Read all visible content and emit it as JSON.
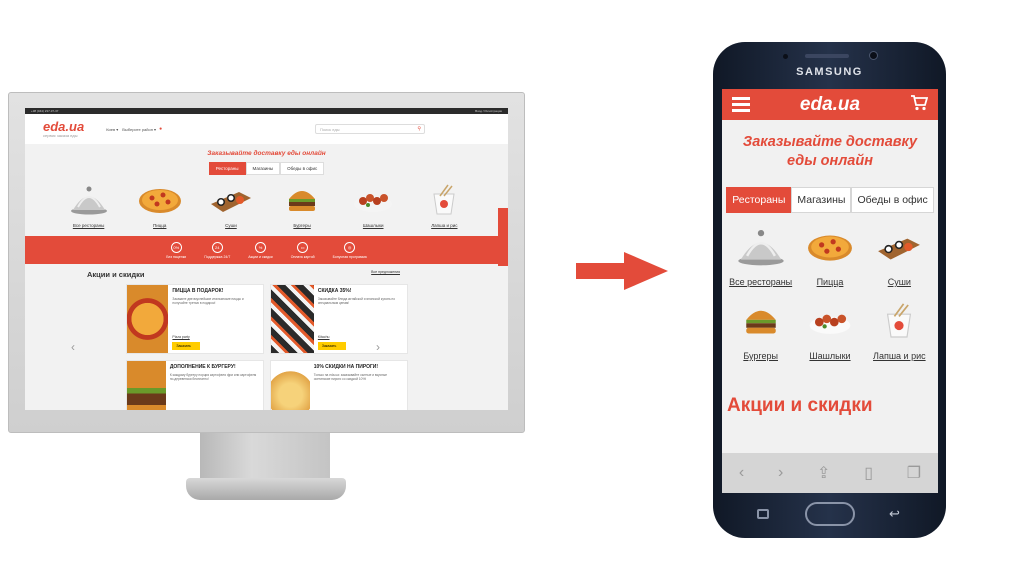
{
  "desktop": {
    "topbar": {
      "phone": "+38 (044) 237-37-37",
      "login": "Вход / Регистрация"
    },
    "logo": {
      "text": "eda.ua",
      "tagline": "сервис заказа еды"
    },
    "city": "Киев ▾",
    "district": "Выберите район ▾",
    "search_placeholder": "Поиск еды",
    "headline": "Заказывайте доставку еды онлайн",
    "tabs": [
      "Рестораны",
      "Магазины",
      "Обеды в офис"
    ],
    "categories": [
      "Все рестораны",
      "Пицца",
      "Суши",
      "Бургеры",
      "Шашлыки",
      "Лапша и рис"
    ],
    "features": [
      {
        "icon": "0%",
        "label": "Без наценки"
      },
      {
        "icon": "24",
        "label": "Поддержка 24/7"
      },
      {
        "icon": "%",
        "label": "Акции и скидки"
      },
      {
        "icon": "▭",
        "label": "Оплата картой"
      },
      {
        "icon": "◎",
        "label": "Бонусная программа"
      }
    ],
    "promo_title": "Акции и скидки",
    "promo_all": "Все предложения",
    "promos": [
      {
        "title": "ПИЦЦА В ПОДАРОК!",
        "text": "Закажите две вкуснейшие итальянские пиццы и получайте третью в подарок!",
        "link": "Pizza party",
        "button": "Заказать"
      },
      {
        "title": "СКИДКА 35%!",
        "text": "Заказывайте блюда китайской и японской кухонь по специальным ценам!",
        "link": "Kitachu",
        "button": "Заказать"
      },
      {
        "title": "ДОПОЛНЕНИЕ К БУРГЕРУ!",
        "text": "К каждому бургеру порция картофеля фри или картофеля по-деревенски бесплатно!",
        "link": "",
        "button": ""
      },
      {
        "title": "10% СКИДКИ НА ПИРОГИ!",
        "text": "Только на eda.ua: заказывайте сытные и вкусные осетинские пироги со скидкой 10%!",
        "link": "",
        "button": ""
      }
    ],
    "side_tab": "Помощь онлайн"
  },
  "phone": {
    "brand": "SAMSUNG",
    "logo": "eda.ua",
    "headline": "Заказывайте доставку еды онлайн",
    "tabs": [
      "Рестораны",
      "Магазины",
      "Обеды в офис"
    ],
    "categories": [
      "Все рестораны",
      "Пицца",
      "Суши",
      "Бургеры",
      "Шашлыки",
      "Лапша и рис"
    ],
    "promo_title": "Акции и скидки"
  },
  "colors": {
    "accent": "#e34b3a",
    "button_yellow": "#ffcc00",
    "phone_body": "#1a2436"
  }
}
